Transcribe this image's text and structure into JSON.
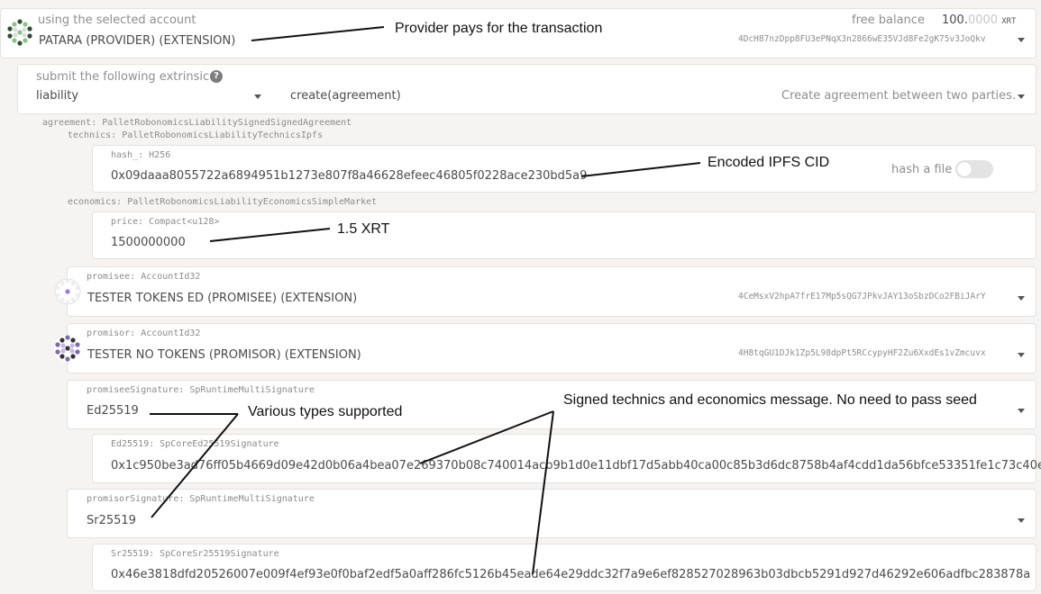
{
  "account": {
    "label": "using the selected account",
    "value": "PATARA (PROVIDER) (EXTENSION)",
    "free_label": "free balance",
    "free_int": "100.",
    "free_dec": "0000",
    "free_unit": "XRT",
    "address": "4DcH87nzDpp8FU3ePNqX3n2866wE35VJd8Fe2gK75v3JoQkv"
  },
  "extrinsic": {
    "label": "submit the following extrinsic",
    "help": "?",
    "module": "liability",
    "method": "create(agreement)",
    "description": "Create agreement between two parties."
  },
  "agreement_label": "agreement: PalletRobonomicsLiabilitySignedSignedAgreement",
  "technics_label": "technics: PalletRobonomicsLiabilityTechnicsIpfs",
  "hash": {
    "label": "hash_: H256",
    "value": "0x09daaa8055722a6894951b1273e807f8a46628efeec46805f0228ace230bd5a9",
    "toggle_label": "hash a file"
  },
  "economics_label": "economics: PalletRobonomicsLiabilityEconomicsSimpleMarket",
  "price": {
    "label": "price: Compact<u128>",
    "value": "1500000000"
  },
  "promisee": {
    "label": "promisee: AccountId32",
    "value": "TESTER TOKENS ED (PROMISEE) (EXTENSION)",
    "address": "4CeMsxV2hpA7frE17Mp5sQG7JPkvJAY13oSbzDCo2FBiJArY"
  },
  "promisor": {
    "label": "promisor: AccountId32",
    "value": "TESTER NO TOKENS (PROMISOR) (EXTENSION)",
    "address": "4H8tqGU1DJk1Zp5L98dpPt5RCcypyHF2Zu6XxdEs1vZmcuvx"
  },
  "promisee_sig": {
    "label": "promiseeSignature: SpRuntimeMultiSignature",
    "value": "Ed25519",
    "inner_label": "Ed25519: SpCoreEd25519Signature",
    "inner_value": "0x1c950be3ad76ff05b4669d09e42d0b06a4bea07e269370b08c740014acb9b1d0e11dbf17d5abb40ca00c85b3d6dc8758b4af4cdd1da56bfce53351fe1c73c40e"
  },
  "promisor_sig": {
    "label": "promisorSignature: SpRuntimeMultiSignature",
    "value": "Sr25519",
    "inner_label": "Sr25519: SpCoreSr25519Signature",
    "inner_value": "0x46e3818dfd20526007e009f4ef93e0f0baf2edf5a0aff286fc5126b45eade64e29ddc32f7a9e6ef828527028963b03dbcb5291d927d46292e606adfbc283878a"
  },
  "annotations": {
    "provider": "Provider pays for the transaction",
    "ipfs": "Encoded IPFS CID",
    "xrt": "1.5 XRT",
    "types": "Various types supported",
    "signed": "Signed technics and economics message. No need to pass seed"
  }
}
